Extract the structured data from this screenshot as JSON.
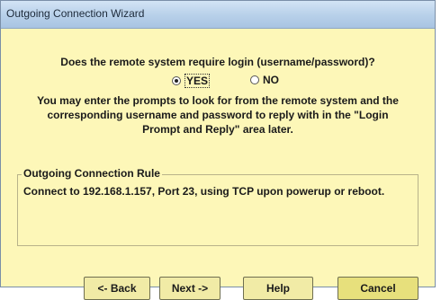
{
  "window": {
    "title": "Outgoing Connection Wizard"
  },
  "question": "Does the remote system require login (username/password)?",
  "options": [
    {
      "label": "YES",
      "selected": true
    },
    {
      "label": "NO",
      "selected": false
    }
  ],
  "info_text": "You may enter the prompts to look for from the remote system and the corresponding username and password to reply with in the \"Login Prompt and Reply\" area later.",
  "rule_group": {
    "legend": "Outgoing Connection Rule",
    "text": "Connect to 192.168.1.157, Port 23, using TCP upon powerup or reboot."
  },
  "buttons": {
    "back": "<- Back",
    "next": "Next ->",
    "help": "Help",
    "cancel": "Cancel"
  },
  "colors": {
    "dialog_background": "#fdf7b8",
    "titlebar": "#b9d1ea",
    "cancel_button": "#e7e07c"
  }
}
